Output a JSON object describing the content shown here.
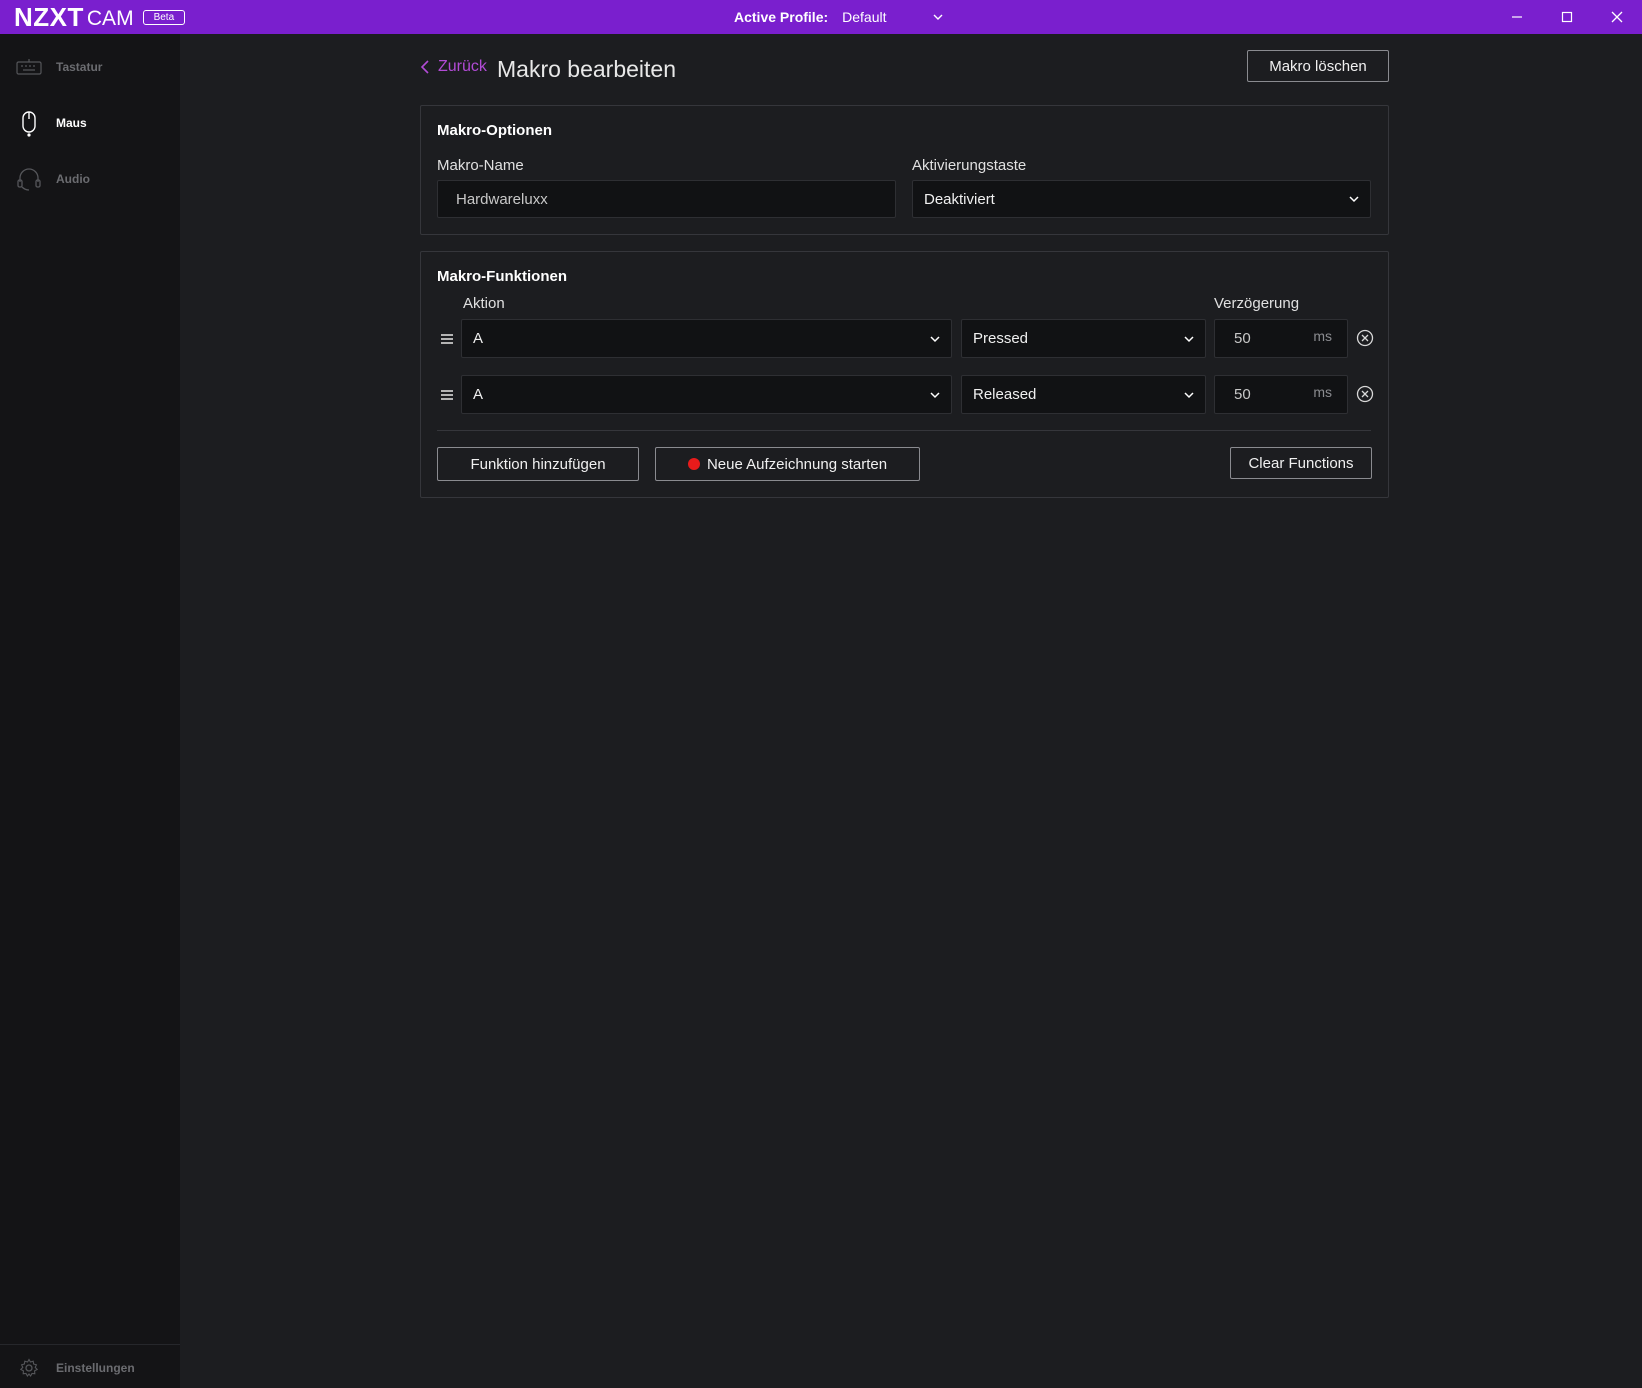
{
  "titlebar": {
    "brand_main": "NZXT",
    "brand_sub": "CAM",
    "badge": "Beta",
    "profile_label": "Active Profile:",
    "profile_value": "Default",
    "icons": [
      "minimize-icon",
      "maximize-icon",
      "close-icon"
    ]
  },
  "sidebar": {
    "items": [
      {
        "label": "Tastatur",
        "icon": "keyboard-icon",
        "active": false
      },
      {
        "label": "Maus",
        "icon": "mouse-icon",
        "active": true
      },
      {
        "label": "Audio",
        "icon": "headset-icon",
        "active": false
      }
    ],
    "settings_label": "Einstellungen",
    "settings_icon": "gear-icon"
  },
  "header": {
    "back_label": "Zurück",
    "title": "Makro bearbeiten",
    "delete_label": "Makro löschen"
  },
  "options": {
    "title": "Makro-Optionen",
    "name_label": "Makro-Name",
    "name_value": "Hardwareluxx",
    "trigger_label": "Aktivierungstaste",
    "trigger_value": "Deaktiviert"
  },
  "functions": {
    "title": "Makro-Funktionen",
    "action_header": "Aktion",
    "delay_header": "Verzögerung",
    "rows": [
      {
        "key": "A",
        "state": "Pressed",
        "delay": "50",
        "unit": "ms"
      },
      {
        "key": "A",
        "state": "Released",
        "delay": "50",
        "unit": "ms"
      }
    ],
    "add_label": "Funktion hinzufügen",
    "record_label": "Neue Aufzeichnung starten",
    "clear_label": "Clear Functions"
  },
  "colors": {
    "accent": "#7a1fce",
    "link": "#b24bd6",
    "background": "#1c1d20",
    "sidebar": "#141416",
    "record": "#e81b1b"
  }
}
